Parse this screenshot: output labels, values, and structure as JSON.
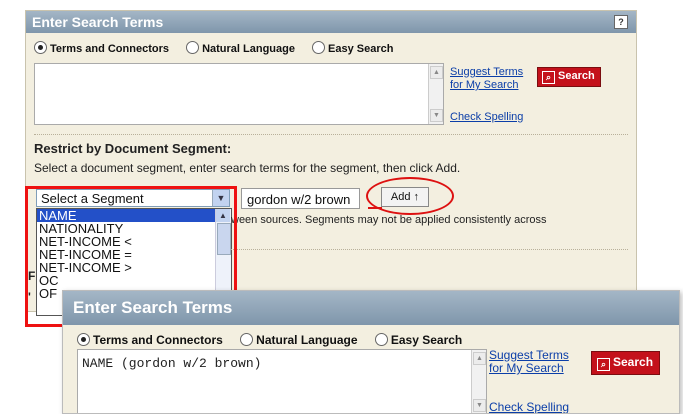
{
  "panel": {
    "title": "Enter Search Terms",
    "help_label": "?",
    "search_types": [
      "Terms and Connectors",
      "Natural Language",
      "Easy Search"
    ],
    "selected_search_type": "Terms and Connectors",
    "suggest_line1": "Suggest Terms",
    "suggest_line2": "for My Search",
    "check_spelling": "Check Spelling",
    "search_button": "Search"
  },
  "restrict": {
    "title": "Restrict by Document Segment:",
    "description": "Select a document segment, enter search terms for the segment, then click Add.",
    "segment_placeholder": "Select a Segment",
    "segment_options": [
      "NAME",
      "NATIONALITY",
      "NET-INCOME <",
      "NET-INCOME =",
      "NET-INCOME >",
      "OC",
      "OF"
    ],
    "selected_segment": "NAME",
    "term_value": "gordon w/2 brown",
    "add_button": "Add ↑",
    "note": "ween sources. Segments may not be applied consistently across",
    "hidden_peek_1": "F",
    "hidden_peek_2": "'"
  },
  "inset": {
    "title": "Enter Search Terms",
    "search_types": [
      "Terms and Connectors",
      "Natural Language",
      "Easy Search"
    ],
    "query_value": "NAME (gordon w/2 brown)",
    "suggest_line1": "Suggest Terms",
    "suggest_line2": "for My Search",
    "check_spelling": "Check Spelling",
    "search_button": "Search"
  },
  "colors": {
    "panel_bg": "#f3efe0",
    "header_blue": "#8ea4b8",
    "search_red": "#c4111b",
    "highlight_red": "#e11111",
    "link_blue": "#0b3ea8",
    "selection_blue": "#2350c8"
  }
}
